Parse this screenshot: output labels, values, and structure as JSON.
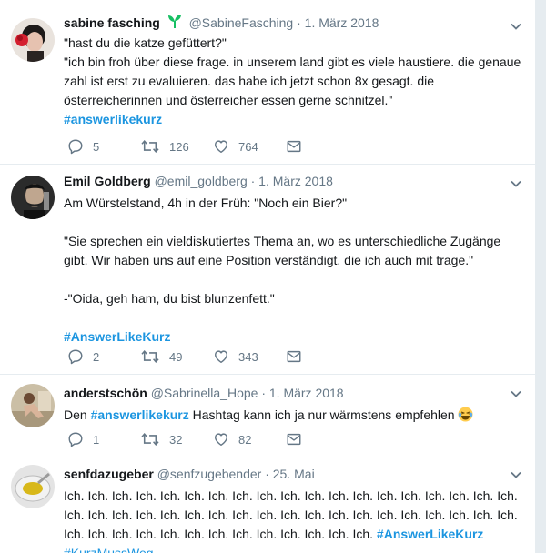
{
  "tweets": [
    {
      "name": "sabine fasching",
      "handle": "@SabineFasching",
      "date": "· 1. März 2018",
      "lines": [
        "\"hast du die katze gefüttert?\"",
        "\"ich bin froh über diese frage. in unserem land gibt es viele haustiere. die genaue zahl ist erst zu evaluieren. das habe ich jetzt schon 8x gesagt. die österreicherinnen und österreicher essen gerne schnitzel.\""
      ],
      "hashtag": "#answerlikekurz",
      "replies": "5",
      "retweets": "126",
      "likes": "764"
    },
    {
      "name": "Emil Goldberg",
      "handle": "@emil_goldberg",
      "date": "· 1. März 2018",
      "lines": [
        "Am Würstelstand, 4h in der Früh:  \"Noch ein Bier?\"",
        "",
        "\"Sie sprechen ein vieldiskutiertes Thema an, wo es unterschiedliche Zugänge gibt. Wir haben uns auf eine Position verständigt, die ich auch mit trage.\"",
        "",
        "-\"Oida, geh ham, du bist blunzenfett.\"",
        ""
      ],
      "hashtag": "#AnswerLikeKurz",
      "replies": "2",
      "retweets": "49",
      "likes": "343"
    },
    {
      "name": "anderstschön",
      "handle": "@Sabrinella_Hope",
      "date": "· 1. März 2018",
      "text_before": "Den ",
      "hashtag": "#answerlikekurz",
      "text_after": " Hashtag kann ich ja nur wärmstens empfehlen ",
      "replies": "1",
      "retweets": "32",
      "likes": "82"
    },
    {
      "name": "senfdazugeber",
      "handle": "@senfzugebender",
      "date": "· 25. Mai",
      "text": "Ich. Ich. Ich. Ich. Ich. Ich. Ich. Ich. Ich. Ich. Ich. Ich. Ich. Ich. Ich. Ich. Ich. Ich. Ich. Ich. Ich. Ich. Ich. Ich. Ich. Ich. Ich. Ich. Ich. Ich. Ich. Ich. Ich. Ich. Ich. Ich. Ich. Ich. Ich. Ich. Ich. Ich. Ich. Ich. Ich. Ich. Ich. Ich. Ich. Ich. Ich. ",
      "hashtag": "#AnswerLikeKurz",
      "hashtag2": "#KurzMussWeg"
    }
  ],
  "colors": {
    "link": "#1b95e0",
    "muted": "#657786",
    "leaf": "#17bf63"
  },
  "icons": [
    "reply-icon",
    "retweet-icon",
    "like-icon",
    "message-icon",
    "chevron-down-icon",
    "leaf-icon",
    "laughing-emoji-icon"
  ]
}
